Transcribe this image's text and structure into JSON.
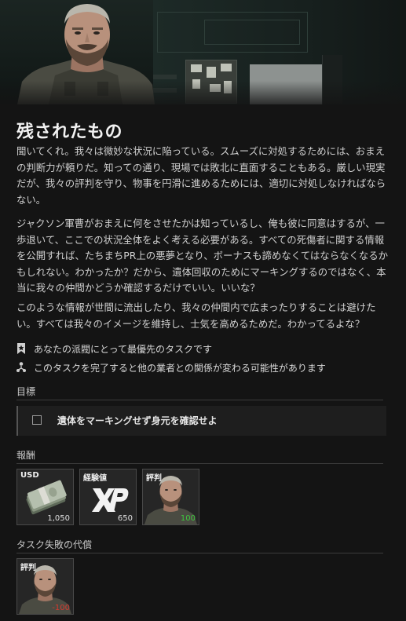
{
  "task": {
    "title": "残されたもの",
    "paragraphs": [
      {
        "lines": [
          "聞いてくれ。我々は微妙な状況に陥っている。スムーズに対処するためには、おまえ",
          "の判断力が頼りだ。知っての通り、現場では敗北に直面することもある。厳しい現実",
          "だが、我々の評判を守り、物事を円滑に進めるためには、適切に対処しなければなら",
          "ない。"
        ]
      },
      {
        "lines": [
          "ジャクソン軍曹がおまえに何をさせたかは知っているし、俺も彼に同意はするが、一",
          "歩退いて、ここでの状況全体をよく考える必要がある。すべての死傷者に関する情報",
          "を公開すれば、たちまちPR上の悪夢となり、ボーナスも諦めなくてはならなくなるか",
          "もしれない。わかったか？だから、遺体回収のためにマーキングするのではなく、本",
          "当に我々の仲間かどうか確認するだけでいい。いいな？"
        ]
      },
      {
        "lines": [
          "このような情報が世間に流出したり、我々の仲間内で広まったりすることは避けた",
          "い。すべては我々のイメージを維持し、士気を高めるためだ。わかってるよな？"
        ]
      }
    ],
    "flags": [
      {
        "icon": "bookmark-star-icon",
        "text": "あなたの派閥にとって最優先のタスクです"
      },
      {
        "icon": "network-icon",
        "text": "このタスクを完了すると他の業者との関係が変わる可能性があります"
      }
    ]
  },
  "objectives": {
    "heading": "目標",
    "items": [
      {
        "text": "遺体をマーキングせず身元を確認せよ",
        "checked": false
      }
    ]
  },
  "rewards": {
    "heading": "報酬",
    "items": [
      {
        "label": "USD",
        "value": "1,050",
        "icon": "cash-icon"
      },
      {
        "label": "経験値",
        "value": "650",
        "icon": "xp-icon"
      },
      {
        "label": "評判",
        "value": "100",
        "icon": "portrait-icon",
        "value_color": "#3fc53f"
      }
    ]
  },
  "failure": {
    "heading": "タスク失敗の代償",
    "items": [
      {
        "label": "評判",
        "value": "-100",
        "icon": "portrait-icon",
        "value_color": "#d43a2f"
      }
    ]
  }
}
